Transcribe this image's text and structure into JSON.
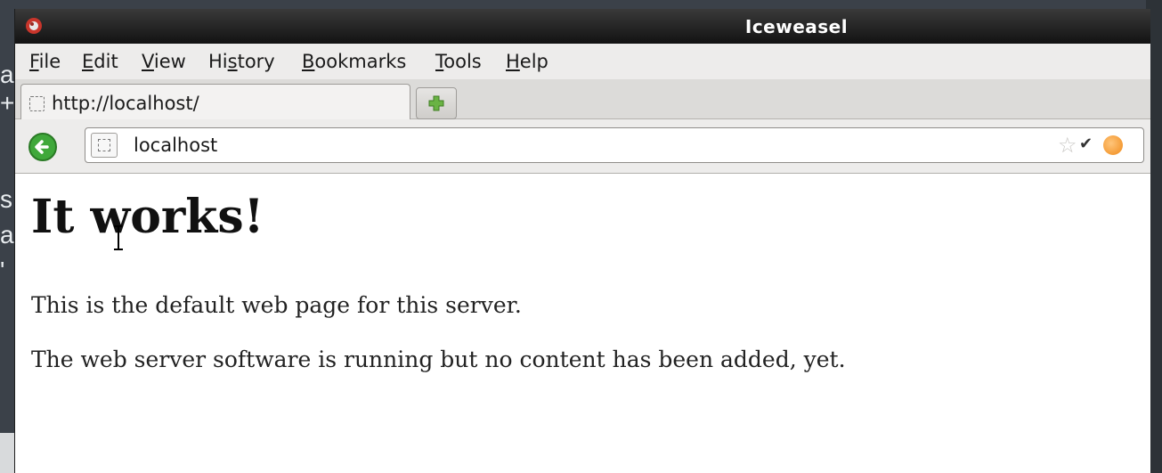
{
  "background": {
    "fragments": [
      "a",
      "+",
      "s",
      "a",
      "'"
    ]
  },
  "window": {
    "title": "Iceweasel"
  },
  "menubar": {
    "items": [
      {
        "mnemonic": "F",
        "rest": "ile"
      },
      {
        "mnemonic": "E",
        "rest": "dit"
      },
      {
        "mnemonic": "V",
        "rest": "iew"
      },
      {
        "pre": "Hi",
        "mnemonic": "s",
        "rest": "tory"
      },
      {
        "mnemonic": "B",
        "rest": "ookmarks"
      },
      {
        "mnemonic": "T",
        "rest": "ools"
      },
      {
        "mnemonic": "H",
        "rest": "elp"
      }
    ]
  },
  "tabs": [
    {
      "label": "http://localhost/"
    }
  ],
  "navbar": {
    "url": "localhost"
  },
  "page": {
    "heading": "It works!",
    "paragraphs": [
      "This is the default web page for this server.",
      "The web server software is running but no content has been added, yet."
    ]
  },
  "colors": {
    "titlebar": "#1a1a1a",
    "chrome": "#edeceb",
    "back_button": "#3fa83a",
    "new_tab_plus": "#6ab344",
    "feed_icon": "#f08a1a"
  },
  "icons": [
    "iceweasel-icon",
    "page-icon",
    "plus-icon",
    "back-arrow-icon",
    "star-icon",
    "chevron-down-icon",
    "feed-icon"
  ]
}
